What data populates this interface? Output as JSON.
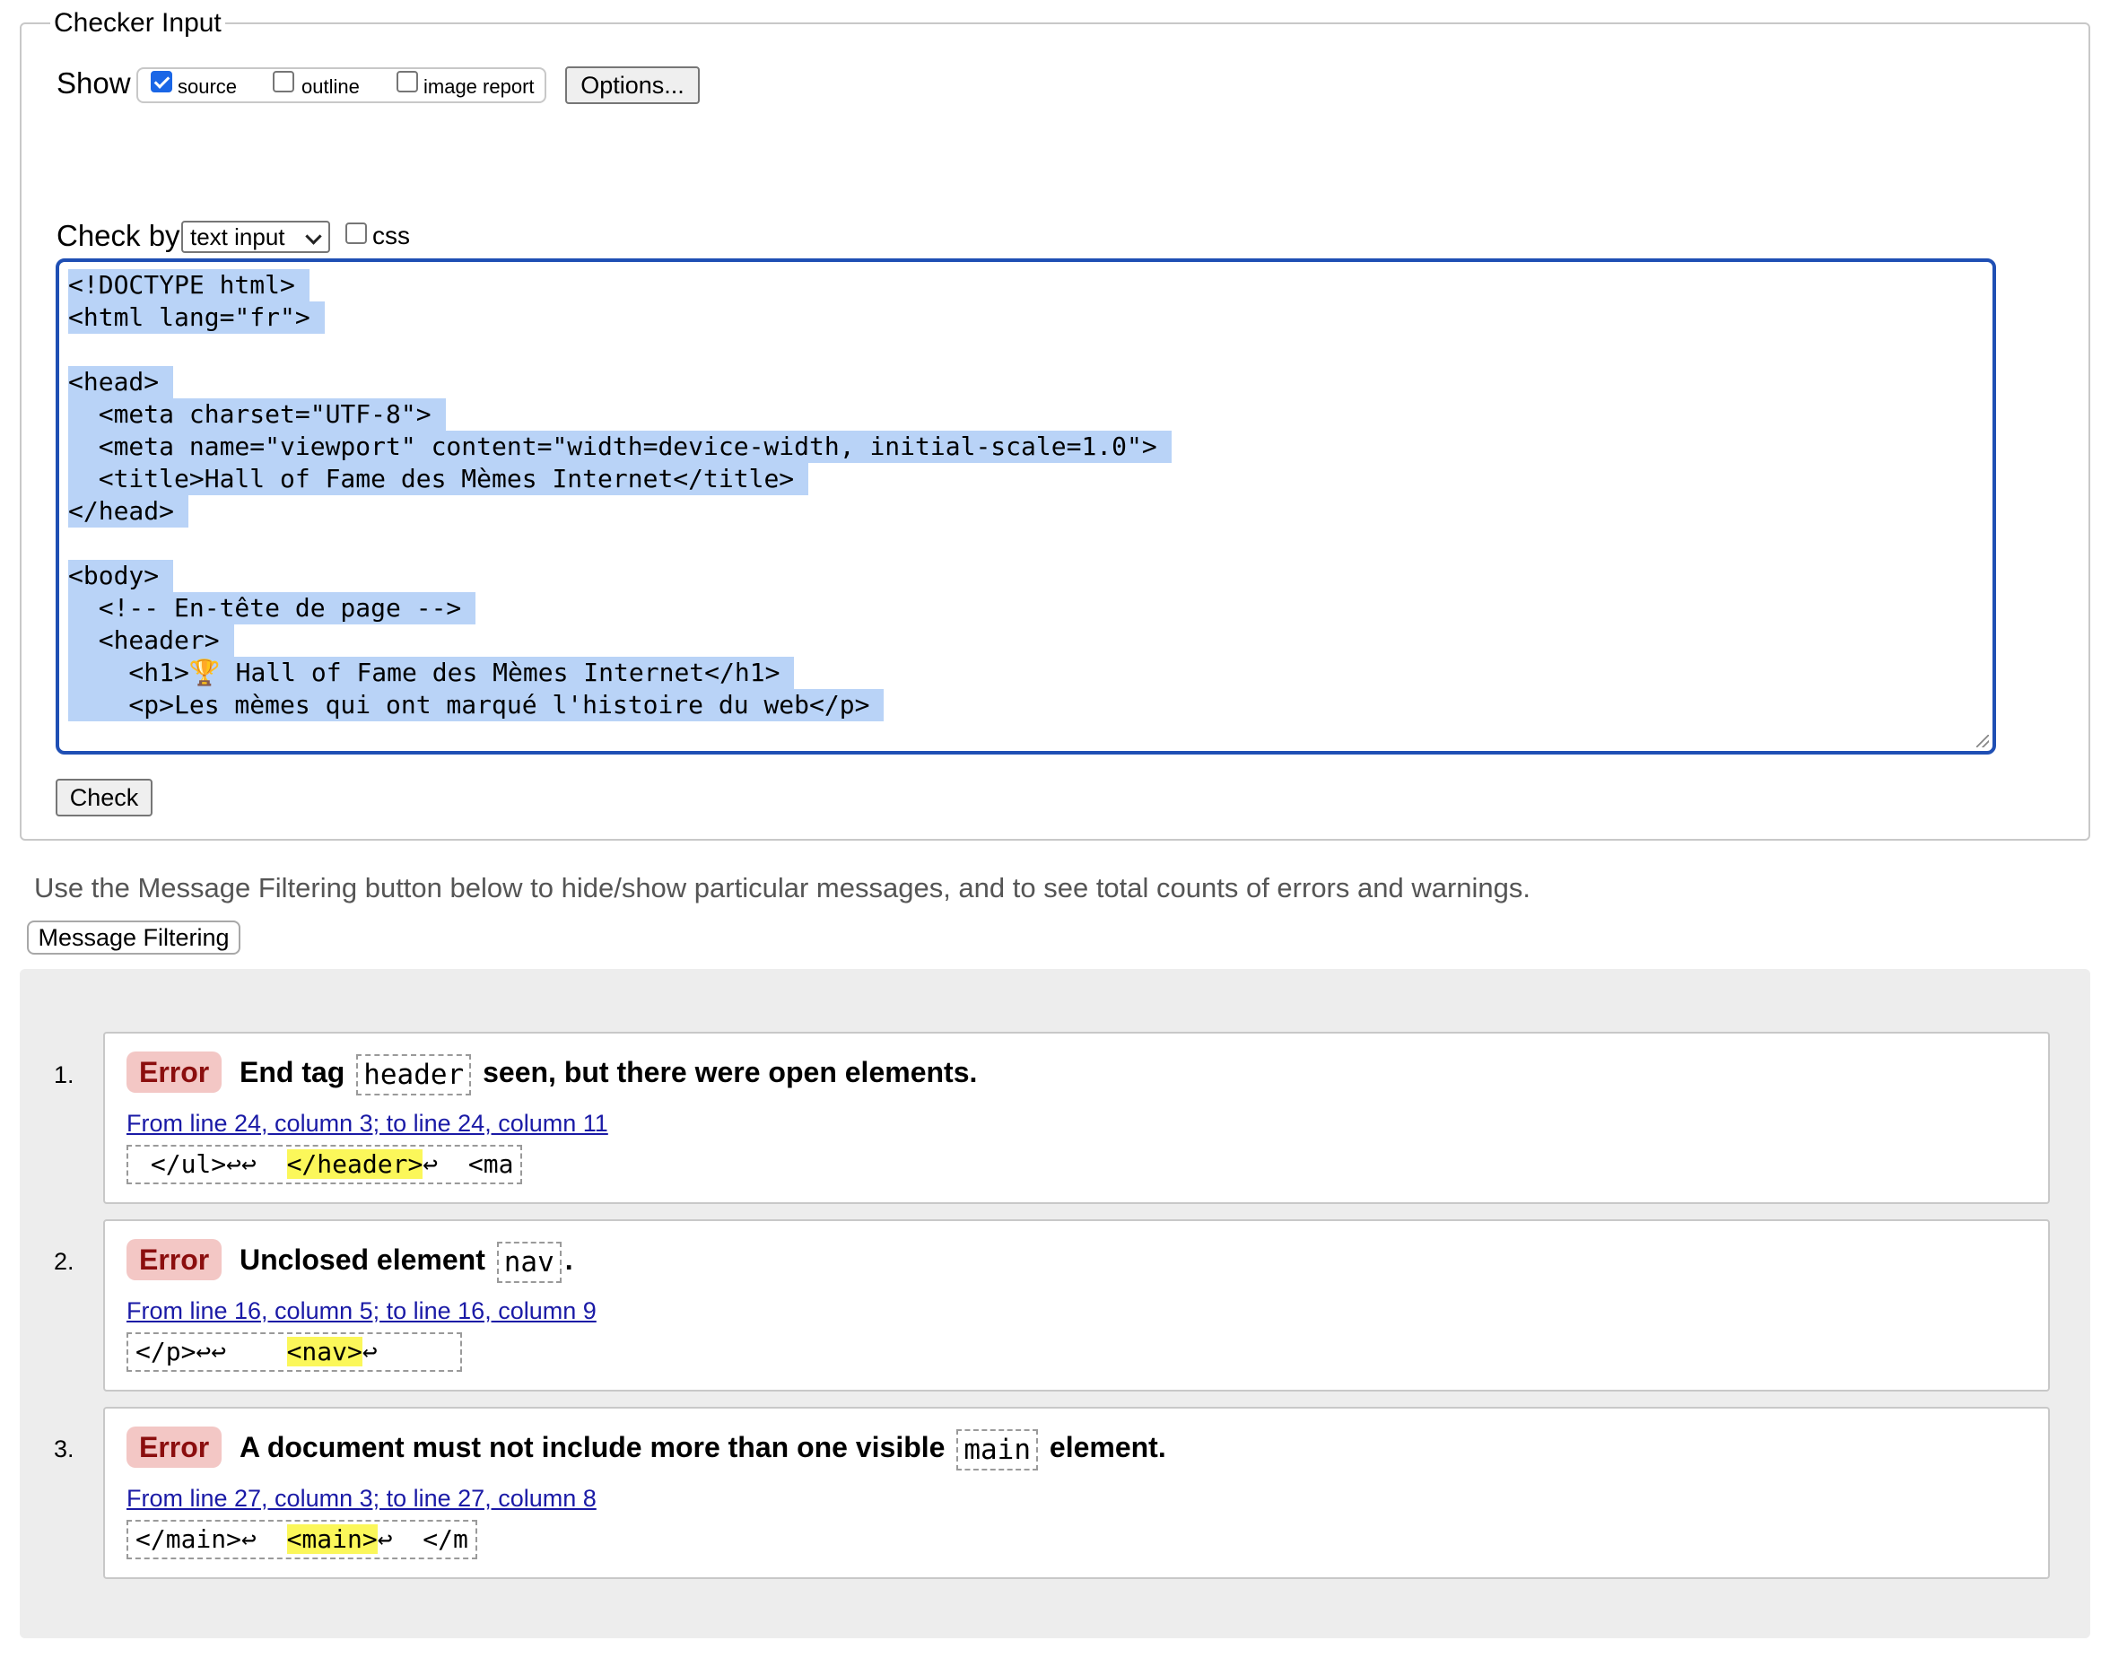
{
  "checker": {
    "legend": "Checker Input",
    "show_label": "Show",
    "options": [
      {
        "label": "source",
        "checked": true
      },
      {
        "label": "outline",
        "checked": false
      },
      {
        "label": "image report",
        "checked": false
      }
    ],
    "options_button": "Options...",
    "check_by_label": "Check by",
    "check_by_value": "text input",
    "css_label": "css",
    "css_checked": false,
    "source_lines": [
      "<!DOCTYPE html>",
      "<html lang=\"fr\">",
      "",
      "<head>",
      "  <meta charset=\"UTF-8\">",
      "  <meta name=\"viewport\" content=\"width=device-width, initial-scale=1.0\">",
      "  <title>Hall of Fame des Mèmes Internet</title>",
      "</head>",
      "",
      "<body>",
      "  <!-- En-tête de page -->",
      "  <header>",
      "    <h1>🏆 Hall of Fame des Mèmes Internet</h1>",
      "    <p>Les mèmes qui ont marqué l'histoire du web</p>",
      ""
    ],
    "check_button": "Check"
  },
  "hint": "Use the Message Filtering button below to hide/show particular messages, and to see total counts of errors and warnings.",
  "filter_button": "Message Filtering",
  "messages": [
    {
      "num": "1.",
      "type": "Error",
      "pre": "End tag",
      "code": "header",
      "post": "seen, but there were open elements.",
      "location": "From line 24, column 3; to line 24, column 11",
      "extract_before": " </ul>↩↩  ",
      "extract_hl": "</header>",
      "extract_after": "↩  <ma"
    },
    {
      "num": "2.",
      "type": "Error",
      "pre": "Unclosed element",
      "code": "nav",
      "post": ".",
      "location": "From line 16, column 5; to line 16, column 9",
      "extract_before": "</p>↩↩    ",
      "extract_hl": "<nav>",
      "extract_after": "↩      "
    },
    {
      "num": "3.",
      "type": "Error",
      "pre": "A document must not include more than one visible",
      "code": "main",
      "post": "element.",
      "location": "From line 27, column 3; to line 27, column 8",
      "extract_before": "</main>↩  ",
      "extract_hl": "<main>",
      "extract_after": "↩  </m"
    }
  ]
}
